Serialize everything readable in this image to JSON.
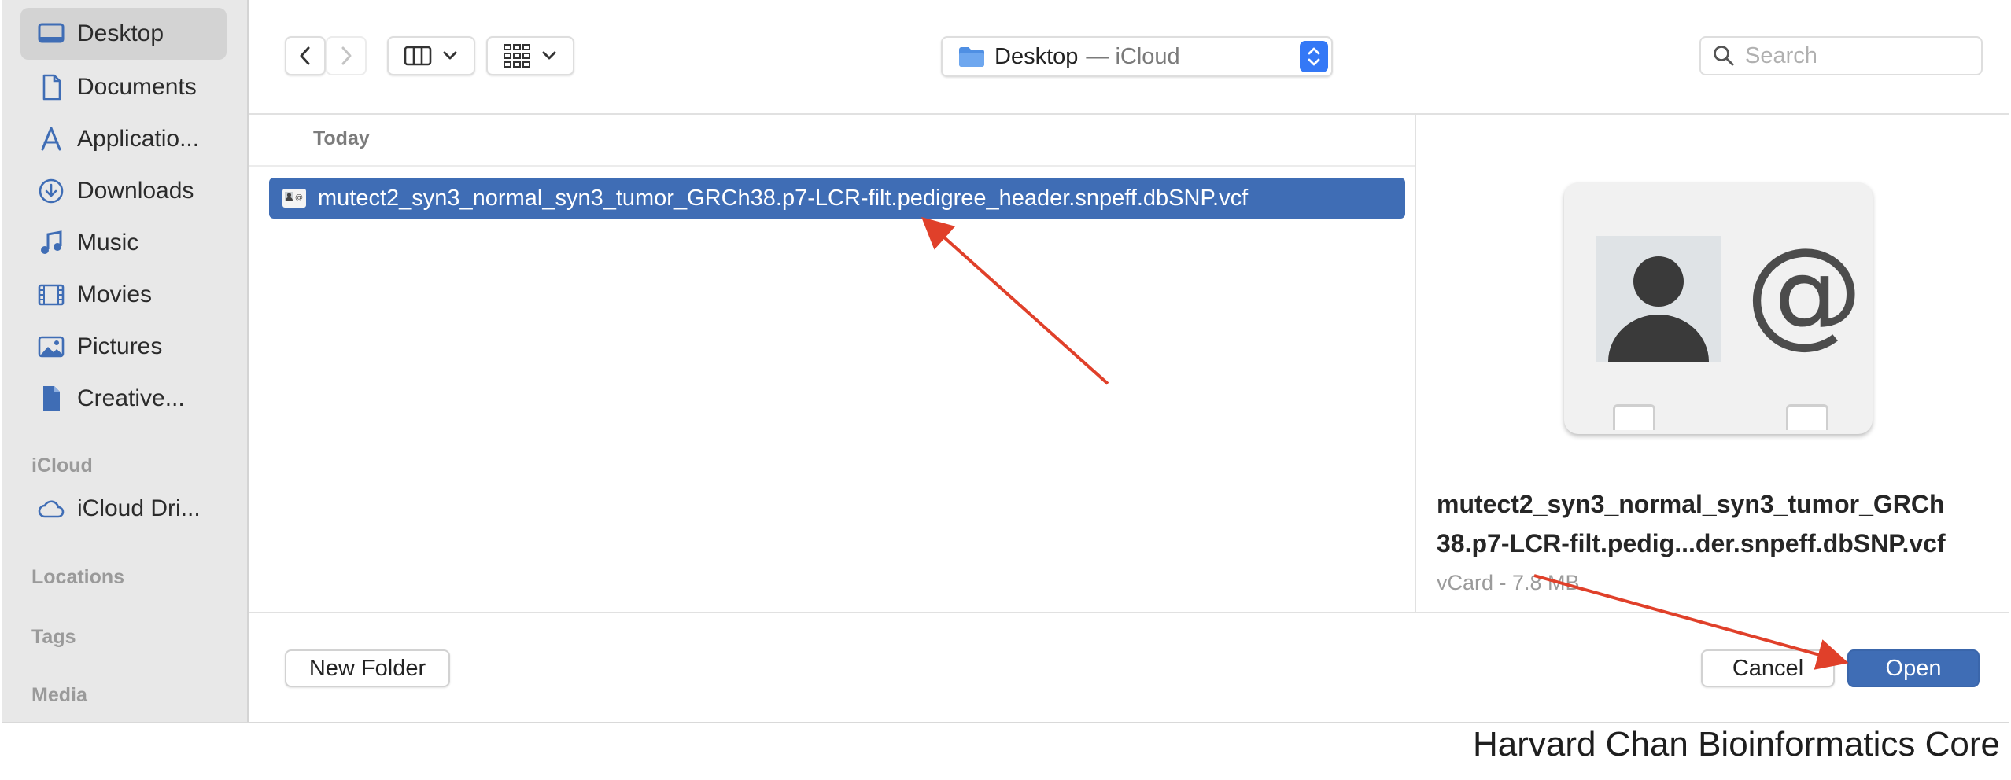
{
  "sidebar": {
    "favorites": [
      {
        "label": "Desktop",
        "icon": "desktop-icon",
        "selected": true
      },
      {
        "label": "Documents",
        "icon": "document-icon"
      },
      {
        "label": "Applicatio...",
        "icon": "applications-icon"
      },
      {
        "label": "Downloads",
        "icon": "download-icon"
      },
      {
        "label": "Music",
        "icon": "music-icon"
      },
      {
        "label": "Movies",
        "icon": "movies-icon"
      },
      {
        "label": "Pictures",
        "icon": "pictures-icon"
      },
      {
        "label": "Creative...",
        "icon": "file-icon"
      }
    ],
    "icloud_heading": "iCloud",
    "icloud_items": [
      {
        "label": "iCloud Dri...",
        "icon": "cloud-icon"
      }
    ],
    "locations_heading": "Locations",
    "tags_heading": "Tags",
    "media_heading": "Media"
  },
  "toolbar": {
    "location_name": "Desktop",
    "location_sub": "— iCloud",
    "search_placeholder": "Search"
  },
  "filelist": {
    "section": "Today",
    "files": [
      {
        "name": "mutect2_syn3_normal_syn3_tumor_GRCh38.p7-LCR-filt.pedigree_header.snpeff.dbSNP.vcf",
        "selected": true
      }
    ]
  },
  "preview": {
    "name_line1": "mutect2_syn3_normal_syn3_tumor_GRCh",
    "name_line2": "38.p7-LCR-filt.pedig...der.snpeff.dbSNP.vcf",
    "meta": "vCard - 7.8 MB"
  },
  "footer": {
    "new_folder_label": "New Folder",
    "cancel_label": "Cancel",
    "open_label": "Open"
  },
  "credit": "Harvard Chan Bioinformatics Core",
  "colors": {
    "accent": "#3f6db5",
    "annotation": "#e0402a",
    "sidebar_bg": "#e8e8e8"
  }
}
